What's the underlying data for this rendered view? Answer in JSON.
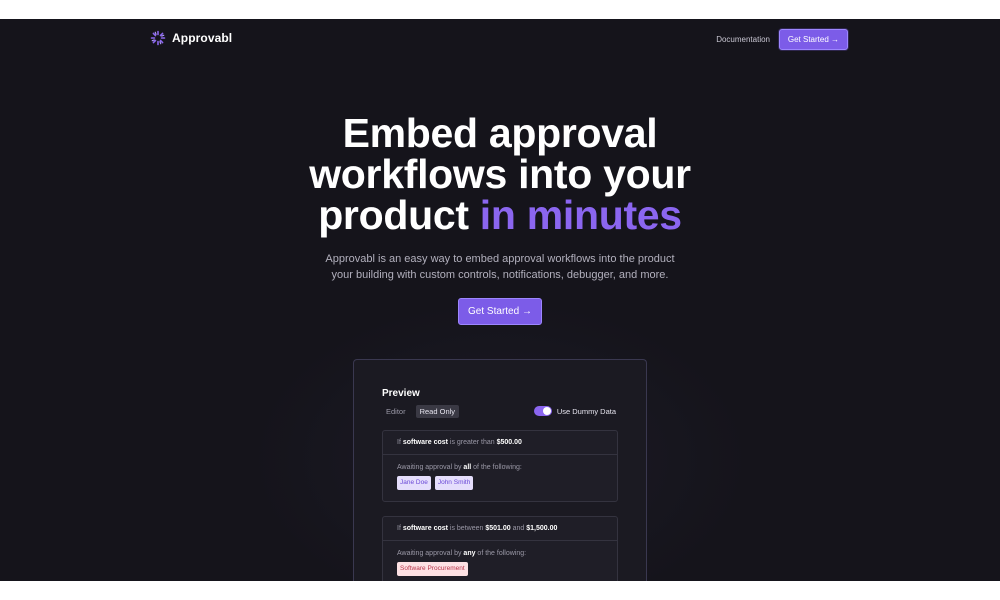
{
  "nav": {
    "brand": "Approvabl",
    "documentation": "Documentation",
    "cta": "Get Started →"
  },
  "hero": {
    "title_line1": "Embed approval",
    "title_line2": "workflows into your",
    "title_line3_plain": "product ",
    "title_line3_accent": "in minutes",
    "subtitle_line1": "Approvabl is an easy way to embed approval workflows into the product",
    "subtitle_line2": "your building with custom controls, notifications, debugger, and more.",
    "cta": "Get Started →"
  },
  "preview": {
    "title": "Preview",
    "tabs": [
      {
        "label": "Editor",
        "active": false
      },
      {
        "label": "Read Only",
        "active": true
      }
    ],
    "toggle_label": "Use Dummy Data",
    "toggle_on": true,
    "rules": [
      {
        "if": "If ",
        "field": "software cost",
        "op": " is greater than ",
        "value1": "$500.00",
        "and": "",
        "value2": "",
        "await_prefix": "Awaiting approval by ",
        "await_quant": "all",
        "await_suffix": " of the following:",
        "approvers": [
          "Jane Doe",
          "John Smith"
        ]
      },
      {
        "if": "If ",
        "field": "software cost",
        "op": " is between ",
        "value1": "$501.00",
        "and": " and ",
        "value2": "$1,500.00",
        "await_prefix": "Awaiting approval by ",
        "await_quant": "any",
        "await_suffix": " of the following:",
        "approvers": [
          "Software Procurement"
        ]
      }
    ]
  },
  "colors": {
    "background": "#15141b",
    "accent": "#7c5ce8",
    "accent_text": "#8b66f0",
    "chip_purple_bg": "#e5defc",
    "chip_pink_bg": "#fde1e4"
  },
  "icons": {
    "logo": "circular-burst-logo-icon",
    "toggle": "toggle-switch-on"
  }
}
